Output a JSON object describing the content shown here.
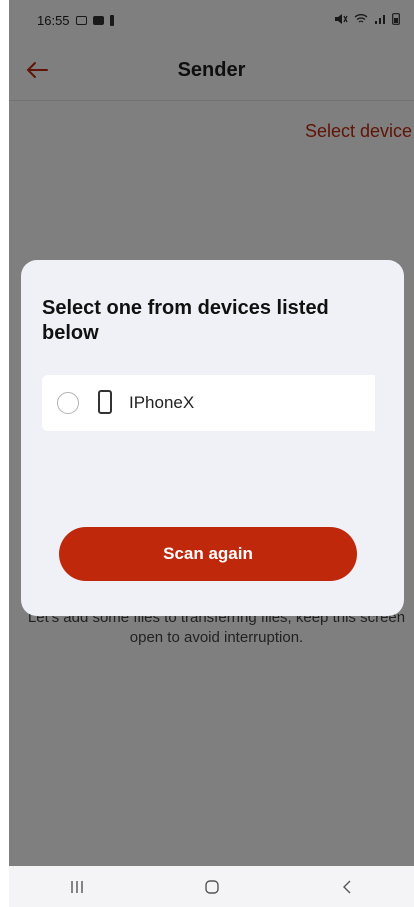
{
  "status_bar": {
    "time": "16:55"
  },
  "app_bar": {
    "title": "Sender",
    "back_icon": "arrow-left-icon"
  },
  "sub_bar": {
    "select_device_label": "Select device"
  },
  "background_hint": "Let's add some files to transferring files, keep this screen open to avoid interruption.",
  "dialog": {
    "title": "Select one from devices listed below",
    "devices": [
      {
        "name": "IPhoneX",
        "icon": "phone-icon",
        "selected": false
      }
    ],
    "scan_button_label": "Scan again"
  },
  "nav_bar": {
    "items": [
      "recent-apps-icon",
      "home-icon",
      "back-icon"
    ]
  },
  "colors": {
    "accent": "#c0280c",
    "dialog_bg": "#eff1f7"
  }
}
